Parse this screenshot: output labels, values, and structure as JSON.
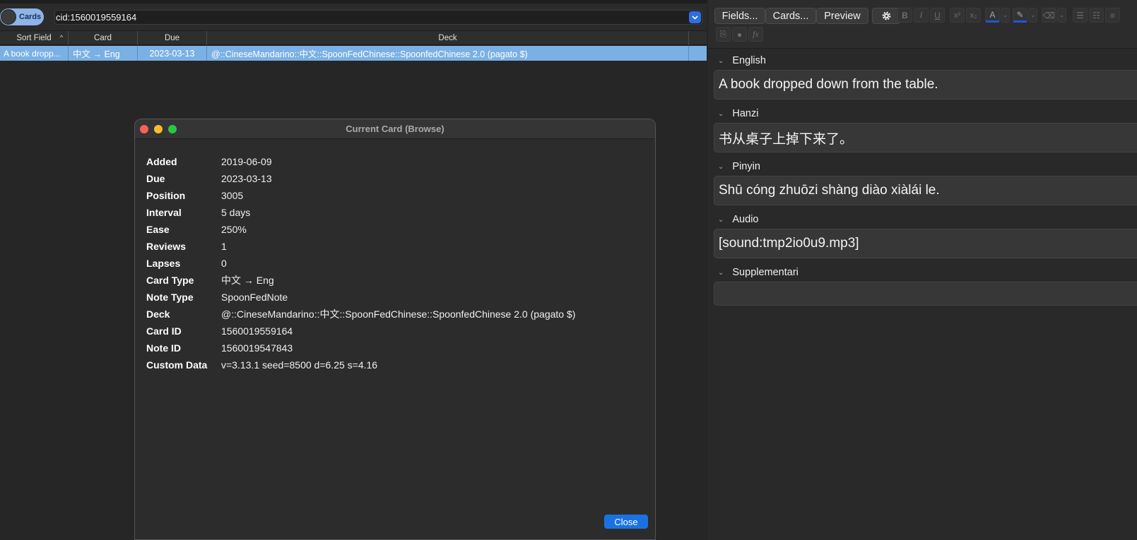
{
  "mode_toggle": {
    "label": "Cards"
  },
  "search": {
    "value": "cid:1560019559164"
  },
  "table": {
    "columns": [
      "Sort Field",
      "Card",
      "Due",
      "Deck"
    ],
    "row": {
      "sort_field": "A book dropp...",
      "card": "中文 → Eng",
      "due": "2023-03-13",
      "deck": "@::CineseMandarino::中文::SpoonFedChinese::SpoonfedChinese 2.0 (pagato $)"
    }
  },
  "dialog": {
    "title": "Current Card (Browse)",
    "stats": [
      {
        "label": "Added",
        "value": "2019-06-09"
      },
      {
        "label": "Due",
        "value": "2023-03-13"
      },
      {
        "label": "Position",
        "value": "3005"
      },
      {
        "label": "Interval",
        "value": "5 days"
      },
      {
        "label": "Ease",
        "value": "250%"
      },
      {
        "label": "Reviews",
        "value": "1"
      },
      {
        "label": "Lapses",
        "value": "0"
      },
      {
        "label": "Card Type",
        "value": "中文 → Eng"
      },
      {
        "label": "Note Type",
        "value": "SpoonFedNote"
      },
      {
        "label": "Deck",
        "value": "@::CineseMandarino::中文::SpoonFedChinese::SpoonfedChinese 2.0 (pagato $)"
      },
      {
        "label": "Card ID",
        "value": "1560019559164"
      },
      {
        "label": "Note ID",
        "value": "1560019547843"
      },
      {
        "label": "Custom Data",
        "value": "v=3.13.1 seed=8500 d=6.25 s=4.16"
      }
    ],
    "close_label": "Close"
  },
  "editor": {
    "toolbar": {
      "fields_label": "Fields...",
      "cards_label": "Cards...",
      "preview_label": "Preview"
    },
    "fields": [
      {
        "label": "English",
        "value": "A book dropped down from the table."
      },
      {
        "label": "Hanzi",
        "value": "书从桌子上掉下来了。"
      },
      {
        "label": "Pinyin",
        "value": "Shū cóng zhuōzi shàng diào xiàlái le."
      },
      {
        "label": "Audio",
        "value": "[sound:tmp2io0u9.mp3]"
      },
      {
        "label": "Supplementari",
        "value": ""
      }
    ]
  },
  "colors": {
    "accent": "#1a72e2",
    "selected_row": "#7bb0e4",
    "text_color_swatch": "#2255dd",
    "highlight_swatch": "#2255dd"
  }
}
